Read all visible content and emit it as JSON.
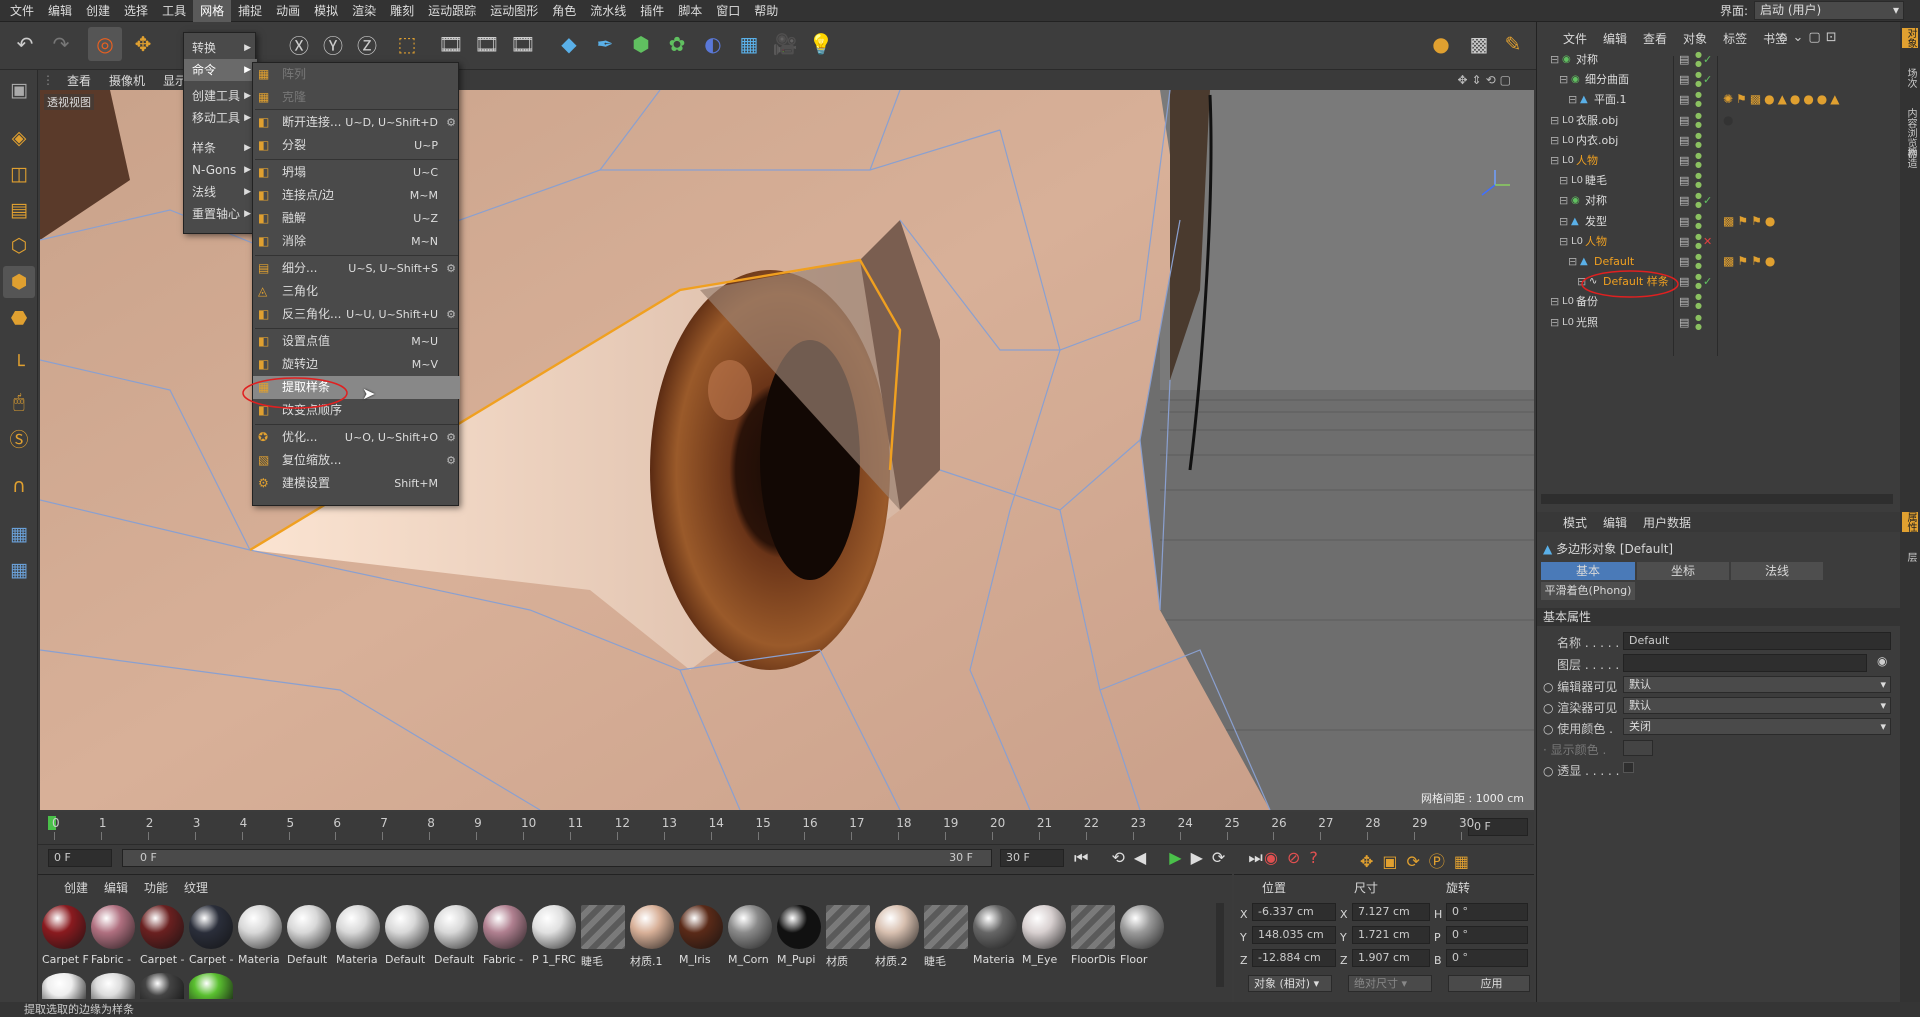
{
  "menubar": {
    "items": [
      "文件",
      "编辑",
      "创建",
      "选择",
      "工具",
      "网格",
      "捕捉",
      "动画",
      "模拟",
      "渲染",
      "雕刻",
      "运动跟踪",
      "运动图形",
      "角色",
      "流水线",
      "插件",
      "脚本",
      "窗口",
      "帮助"
    ],
    "interface_label": "界面:",
    "interface_value": "启动 (用户)"
  },
  "mesh_menu": {
    "items": [
      {
        "label": "转换",
        "sub": true
      },
      {
        "label": "命令",
        "sub": true
      },
      {
        "label": "创建工具",
        "sub": true
      },
      {
        "label": "移动工具",
        "sub": true
      },
      {
        "label": "样条",
        "sub": true
      },
      {
        "label": "N-Gons",
        "sub": true
      },
      {
        "label": "法线",
        "sub": true
      },
      {
        "label": "重置轴心",
        "sub": true
      }
    ]
  },
  "commands_menu": {
    "items": [
      {
        "label": "阵列",
        "shortcut": "",
        "disabled": true
      },
      {
        "label": "克隆",
        "shortcut": "",
        "disabled": true
      },
      {
        "label": "断开连接...",
        "shortcut": "U~D, U~Shift+D",
        "gear": true
      },
      {
        "label": "分裂",
        "shortcut": "U~P"
      },
      {
        "label": "坍塌",
        "shortcut": "U~C"
      },
      {
        "label": "连接点/边",
        "shortcut": "M~M"
      },
      {
        "label": "融解",
        "shortcut": "U~Z"
      },
      {
        "label": "消除",
        "shortcut": "M~N"
      },
      {
        "label": "细分...",
        "shortcut": "U~S, U~Shift+S",
        "gear": true
      },
      {
        "label": "三角化",
        "shortcut": ""
      },
      {
        "label": "反三角化...",
        "shortcut": "U~U, U~Shift+U",
        "gear": true
      },
      {
        "label": "设置点值",
        "shortcut": "M~U"
      },
      {
        "label": "旋转边",
        "shortcut": "M~V"
      },
      {
        "label": "提取样条",
        "shortcut": "",
        "highlight": true
      },
      {
        "label": "改变点顺序",
        "shortcut": ""
      },
      {
        "label": "优化...",
        "shortcut": "U~O, U~Shift+O",
        "gear": true
      },
      {
        "label": "复位缩放...",
        "shortcut": "",
        "gear": true
      },
      {
        "label": "建模设置",
        "shortcut": "Shift+M"
      }
    ]
  },
  "viewport": {
    "menu": [
      "查看",
      "摄像机",
      "显示"
    ],
    "label": "透视视图",
    "grid_label": "网格间距 : 1000 cm"
  },
  "timeline": {
    "ticks": [
      "0",
      "1",
      "2",
      "3",
      "4",
      "5",
      "6",
      "7",
      "8",
      "9",
      "10",
      "11",
      "12",
      "13",
      "14",
      "15",
      "16",
      "17",
      "18",
      "19",
      "20",
      "21",
      "22",
      "23",
      "24",
      "25",
      "26",
      "27",
      "28",
      "29",
      "30"
    ],
    "current": "0 F",
    "start": "0 F",
    "range_start": "0 F",
    "range_end": "30 F",
    "end": "30 F"
  },
  "materials": {
    "menu": [
      "创建",
      "编辑",
      "功能",
      "纹理"
    ],
    "items": [
      {
        "name": "Carpet F",
        "color": "#8a1a1f"
      },
      {
        "name": "Fabric -",
        "color": "#b07080"
      },
      {
        "name": "Carpet -",
        "color": "#6a2020"
      },
      {
        "name": "Carpet -",
        "color": "#2a2e3a"
      },
      {
        "name": "Materia",
        "color": "#d8d8d8"
      },
      {
        "name": "Default",
        "color": "#d8d8d8"
      },
      {
        "name": "Materia",
        "color": "#d8d8d8"
      },
      {
        "name": "Default",
        "color": "#d8d8d8"
      },
      {
        "name": "Default",
        "color": "#d8d8d8"
      },
      {
        "name": "Fabric -",
        "color": "#b08090"
      },
      {
        "name": "P 1_FRC",
        "color": "#e0e0e0"
      },
      {
        "name": "睫毛",
        "color": "#777777"
      },
      {
        "name": "材质.1",
        "color": "#d8b098"
      },
      {
        "name": "M_Iris",
        "color": "#5a2a18"
      },
      {
        "name": "M_Corn",
        "color": "#8a8a8a"
      },
      {
        "name": "M_Pupi",
        "color": "#111111"
      },
      {
        "name": "材质",
        "color": "#777777"
      },
      {
        "name": "材质.2",
        "color": "#d8c0b0"
      },
      {
        "name": "睫毛",
        "color": "#777777"
      },
      {
        "name": "Materia",
        "color": "#666666"
      },
      {
        "name": "M_Eye",
        "color": "#d8d0d0"
      },
      {
        "name": "FloorDis",
        "color": "#777777"
      },
      {
        "name": "Floor",
        "color": "#9a9a9a"
      }
    ]
  },
  "coords": {
    "headers": [
      "位置",
      "尺寸",
      "旋转"
    ],
    "pos": {
      "x": "-6.337 cm",
      "y": "148.035 cm",
      "z": "-12.884 cm"
    },
    "size": {
      "x": "7.127 cm",
      "y": "1.721 cm",
      "z": "1.907 cm"
    },
    "rot": {
      "h": "0 °",
      "p": "0 °",
      "b": "0 °"
    },
    "mode": "对象 (相对)",
    "size_mode": "绝对尺寸",
    "apply": "应用"
  },
  "objects": {
    "menu": [
      "文件",
      "编辑",
      "查看",
      "对象",
      "标签",
      "书签"
    ],
    "rows": [
      {
        "name": "对称",
        "indent": 1
      },
      {
        "name": "细分曲面",
        "indent": 2
      },
      {
        "name": "平面.1",
        "indent": 3
      },
      {
        "name": "衣服.obj",
        "indent": 1
      },
      {
        "name": "内衣.obj",
        "indent": 1
      },
      {
        "name": "人物",
        "indent": 1
      },
      {
        "name": "睫毛",
        "indent": 2
      },
      {
        "name": "对称",
        "indent": 2
      },
      {
        "name": "发型",
        "indent": 2
      },
      {
        "name": "人物",
        "indent": 2
      },
      {
        "name": "Default",
        "indent": 3
      },
      {
        "name": "Default 样条",
        "indent": 4
      },
      {
        "name": "备份",
        "indent": 1
      },
      {
        "name": "光照",
        "indent": 1
      }
    ]
  },
  "attributes": {
    "menu": [
      "模式",
      "编辑",
      "用户数据"
    ],
    "title": "多边形对象 [Default]",
    "tabs": [
      "基本",
      "坐标",
      "法线"
    ],
    "tab2": "平滑着色(Phong)",
    "section": "基本属性",
    "name_label": "名称 . . . . .",
    "name_value": "Default",
    "layer_label": "图层 . . . . .",
    "editor_label": "编辑器可见",
    "editor_value": "默认",
    "render_label": "渲染器可见",
    "render_value": "默认",
    "color_label": "使用颜色 .",
    "color_value": "关闭",
    "display_color_label": "显示颜色 .",
    "xray_label": "透显 . . . . ."
  },
  "side_tabs": [
    "对象",
    "场次",
    "内容浏览器",
    "构造",
    "属性",
    "层"
  ],
  "status": "提取选取的边缘为样条"
}
